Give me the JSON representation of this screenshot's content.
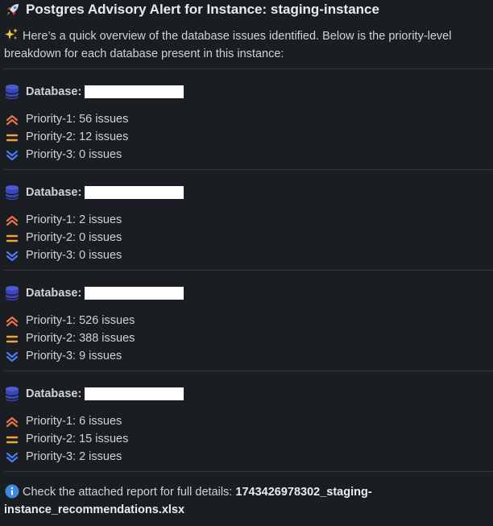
{
  "header": {
    "icon": "rocket-icon",
    "title": "Postgres Advisory Alert for Instance: staging-instance"
  },
  "intro": {
    "icon": "sparkles-icon",
    "text": "Here’s a quick overview of the database issues identified. Below is the priority-level breakdown for each database present in this instance:"
  },
  "databases": [
    {
      "label": "Database:",
      "priorities": [
        {
          "label": "Priority-1: 56 issues",
          "icon": "double-chevron-up-icon"
        },
        {
          "label": "Priority-2: 12 issues",
          "icon": "equals-icon"
        },
        {
          "label": "Priority-3: 0 issues",
          "icon": "double-chevron-down-icon"
        }
      ]
    },
    {
      "label": "Database:",
      "priorities": [
        {
          "label": "Priority-1: 2 issues",
          "icon": "double-chevron-up-icon"
        },
        {
          "label": "Priority-2: 0 issues",
          "icon": "equals-icon"
        },
        {
          "label": "Priority-3: 0 issues",
          "icon": "double-chevron-down-icon"
        }
      ]
    },
    {
      "label": "Database:",
      "priorities": [
        {
          "label": "Priority-1: 526 issues",
          "icon": "double-chevron-up-icon"
        },
        {
          "label": "Priority-2: 388 issues",
          "icon": "equals-icon"
        },
        {
          "label": "Priority-3: 9 issues",
          "icon": "double-chevron-down-icon"
        }
      ]
    },
    {
      "label": "Database:",
      "priorities": [
        {
          "label": "Priority-1: 6 issues",
          "icon": "double-chevron-up-icon"
        },
        {
          "label": "Priority-2: 15 issues",
          "icon": "equals-icon"
        },
        {
          "label": "Priority-3: 2 issues",
          "icon": "double-chevron-down-icon"
        }
      ]
    }
  ],
  "footer": {
    "icon": "info-icon",
    "text": "Check the attached report for full details:",
    "filename": "1743426978302_staging-instance_recommendations.xlsx"
  },
  "colors": {
    "background": "#1a1d21",
    "text": "#d1d2d3",
    "priority1": "#e8734a",
    "priority2": "#f2a33a",
    "priority3": "#4a7bf0",
    "database_icon": "#4f5bd5",
    "info_icon": "#3d8bd9"
  }
}
